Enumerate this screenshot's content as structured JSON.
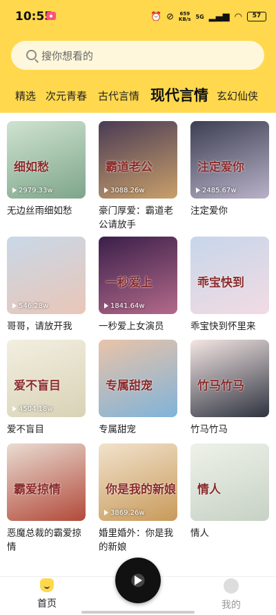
{
  "status_bar": {
    "time": "10:55",
    "net_speed_value": "659",
    "net_speed_unit": "KB/s",
    "signal_label": "5G",
    "battery": "57"
  },
  "search": {
    "placeholder": "搜你想看的"
  },
  "tabs": [
    "精选",
    "次元青春",
    "古代言情",
    "现代言情",
    "玄幻仙侠"
  ],
  "active_tab": "现代言情",
  "books": [
    {
      "title": "无边丝雨细如愁",
      "plays": "2979.33w",
      "cover_text": "细如愁",
      "colors": [
        "#cfe3d0",
        "#7ea58a"
      ]
    },
    {
      "title": "豪门厚爱：霸道老公请放手",
      "plays": "3088.26w",
      "cover_text": "霸道老公",
      "colors": [
        "#4a3b55",
        "#c9a06a"
      ]
    },
    {
      "title": "注定爱你",
      "plays": "2485.67w",
      "cover_text": "注定爱你",
      "colors": [
        "#3c3f52",
        "#b9b2c8"
      ]
    },
    {
      "title": "哥哥，请放开我",
      "plays": "546.28w",
      "cover_text": "",
      "colors": [
        "#c9d8e8",
        "#e9c6b7"
      ]
    },
    {
      "title": "一秒爱上女演员",
      "plays": "1841.64w",
      "cover_text": "一秒爱上",
      "colors": [
        "#3a1f4a",
        "#b46a8a"
      ]
    },
    {
      "title": "乖宝快到怀里来",
      "plays": "",
      "cover_text": "乖宝快到",
      "colors": [
        "#c7d6ea",
        "#f2dbe3"
      ]
    },
    {
      "title": "爱不盲目",
      "plays": "4504.18w",
      "cover_text": "爱不盲目",
      "colors": [
        "#f3efe1",
        "#d8d2b5"
      ]
    },
    {
      "title": "专属甜宠",
      "plays": "",
      "cover_text": "专属甜宠",
      "colors": [
        "#e9c3a9",
        "#7fb3d9"
      ]
    },
    {
      "title": "竹马竹马",
      "plays": "",
      "cover_text": "竹马竹马",
      "colors": [
        "#f4e6e4",
        "#2e3340"
      ]
    },
    {
      "title": "恶魔总裁的霸爱掠情",
      "plays": "",
      "cover_text": "霸爱掠情",
      "colors": [
        "#e9dcd2",
        "#b24a3a"
      ]
    },
    {
      "title": "婚里婚外：你是我的新娘",
      "plays": "3869.26w",
      "cover_text": "你是我的新娘",
      "colors": [
        "#f1e2cc",
        "#c89a5a"
      ]
    },
    {
      "title": "情人",
      "plays": "",
      "cover_text": "情人",
      "colors": [
        "#eef2ea",
        "#c7d1c4"
      ]
    }
  ],
  "bottom_nav": {
    "home": "首页",
    "me": "我的"
  }
}
